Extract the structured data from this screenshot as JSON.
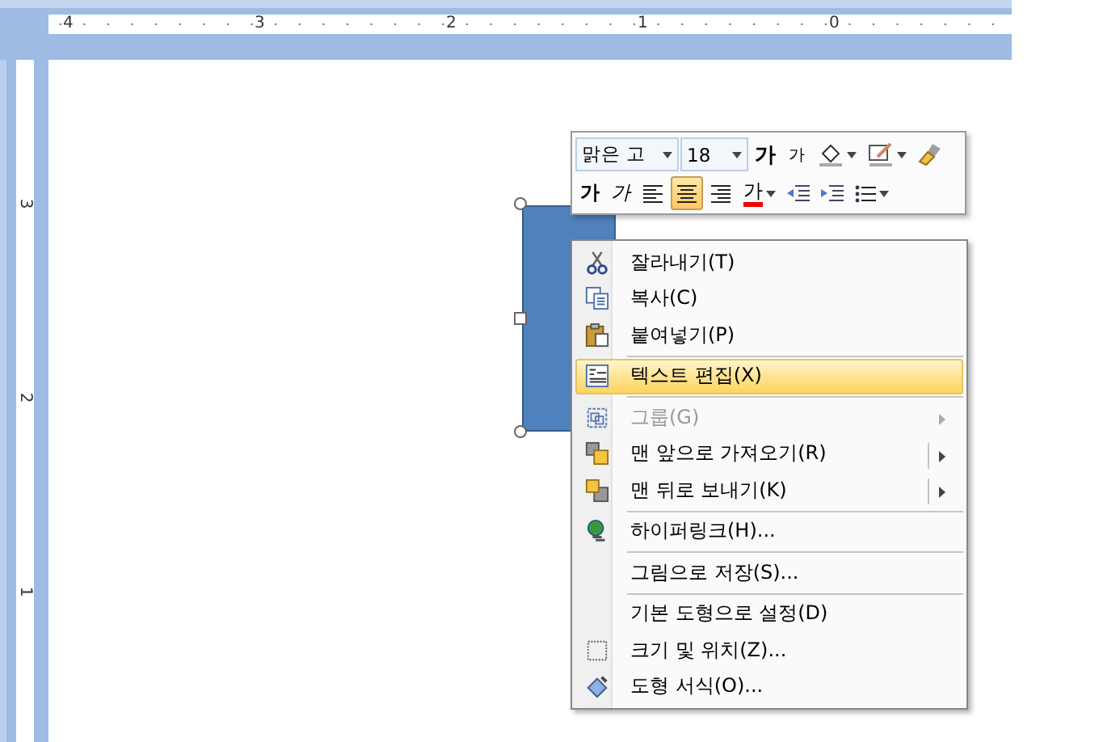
{
  "ruler": {
    "horizontal_labels": [
      "4",
      "3",
      "2",
      "1",
      "0"
    ],
    "vertical_labels": [
      "3",
      "2",
      "1"
    ]
  },
  "mini_toolbar": {
    "font_field": "맑은 고",
    "size_field": "18",
    "row_1": [
      {
        "kind": "grow",
        "label": "가"
      },
      {
        "kind": "shrink",
        "label": "가"
      },
      {
        "kind": "fill"
      },
      {
        "kind": "outline"
      },
      {
        "kind": "painter"
      }
    ],
    "row_2": [
      {
        "kind": "bold",
        "label": "가",
        "selected": false
      },
      {
        "kind": "italic",
        "label": "가",
        "selected": false
      },
      {
        "kind": "align_left",
        "selected": false
      },
      {
        "kind": "align_center",
        "selected": true
      },
      {
        "kind": "align_right",
        "selected": false
      },
      {
        "kind": "font_color",
        "label": "가"
      },
      {
        "kind": "outdent"
      },
      {
        "kind": "indent"
      },
      {
        "kind": "bullets"
      }
    ]
  },
  "context_menu": [
    {
      "kind": "item",
      "label": "잘라내기(T)",
      "selected": false,
      "disabled": false
    },
    {
      "kind": "item",
      "label": "복사(C)",
      "selected": false,
      "disabled": false
    },
    {
      "kind": "item",
      "label": "붙여넣기(P)",
      "selected": false,
      "disabled": false
    },
    {
      "kind": "separator"
    },
    {
      "kind": "item",
      "label": "텍스트 편집(X)",
      "selected": true,
      "disabled": false
    },
    {
      "kind": "separator"
    },
    {
      "kind": "submenu",
      "label": "그룹(G)",
      "selected": false,
      "disabled": true
    },
    {
      "kind": "split_submenu",
      "label": "맨 앞으로 가져오기(R)",
      "selected": false,
      "disabled": false
    },
    {
      "kind": "split_submenu",
      "label": "맨 뒤로 보내기(K)",
      "selected": false,
      "disabled": false
    },
    {
      "kind": "separator"
    },
    {
      "kind": "item",
      "label": "하이퍼링크(H)...",
      "selected": false,
      "disabled": false
    },
    {
      "kind": "separator"
    },
    {
      "kind": "item",
      "label": "그림으로 저장(S)...",
      "selected": false,
      "disabled": false
    },
    {
      "kind": "separator"
    },
    {
      "kind": "item",
      "label": "기본 도형으로 설정(D)",
      "selected": false,
      "disabled": false
    },
    {
      "kind": "item",
      "label": "크기 및 위치(Z)...",
      "selected": false,
      "disabled": false
    },
    {
      "kind": "item",
      "label": "도형 서식(O)...",
      "selected": false,
      "disabled": false
    }
  ]
}
